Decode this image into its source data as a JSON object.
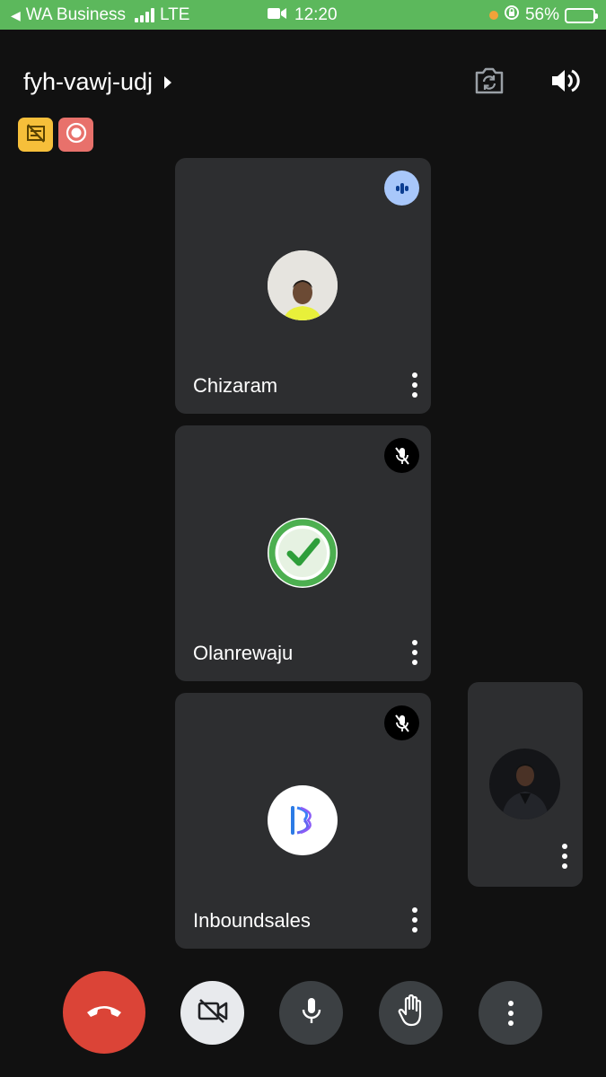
{
  "status_bar": {
    "back_app": "WA Business",
    "network": "LTE",
    "time": "12:20",
    "battery": "56%",
    "battery_level": 0.56
  },
  "header": {
    "meeting_code": "fyh-vawj-udj"
  },
  "participants": [
    {
      "name": "Chizaram",
      "status": "speaking"
    },
    {
      "name": "Olanrewaju",
      "status": "muted"
    },
    {
      "name": "Inboundsales",
      "status": "muted"
    }
  ],
  "self_view": {
    "status": "self"
  },
  "controls": {
    "end_call_color": "#db4437",
    "camera_off_bg": "#e8eaed",
    "control_bg": "#3c4043"
  },
  "colors": {
    "status_bar_bg": "#5cb85c",
    "tile_bg": "#2d2e30",
    "speaking_indicator": "#a8c7fa",
    "badge_yellow": "#f6bf3a",
    "badge_red": "#e8716b"
  }
}
